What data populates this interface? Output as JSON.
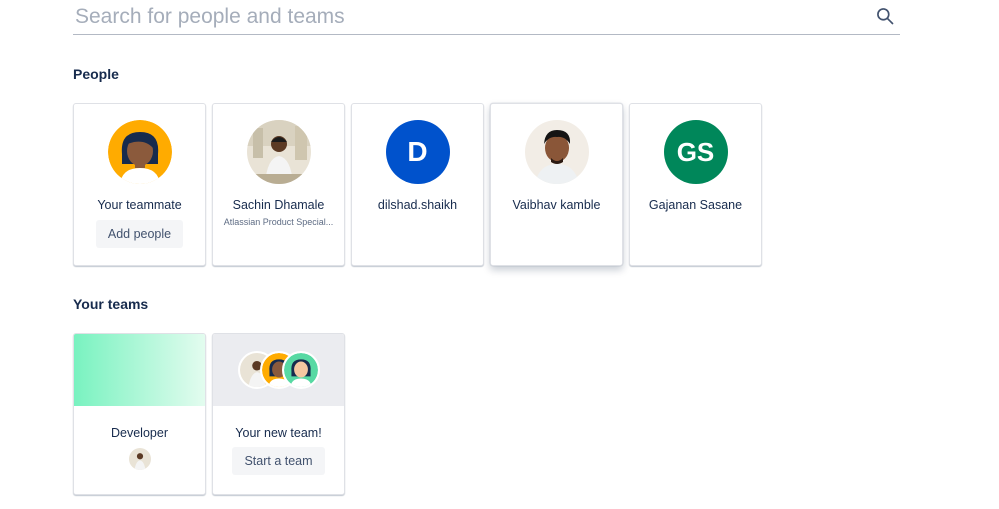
{
  "search": {
    "placeholder": "Search for people and teams",
    "value": ""
  },
  "people_section": {
    "title": "People",
    "cards": [
      {
        "name": "Your teammate",
        "subtitle": "",
        "button": "Add people",
        "avatar": "teammate-illustration"
      },
      {
        "name": "Sachin Dhamale",
        "subtitle": "Atlassian Product Special...",
        "avatar": "photo"
      },
      {
        "name": "dilshad.shaikh",
        "subtitle": "",
        "initials": "D",
        "color": "#0052cc"
      },
      {
        "name": "Vaibhav kamble",
        "subtitle": "",
        "avatar": "photo"
      },
      {
        "name": "Gajanan Sasane",
        "subtitle": "",
        "initials": "GS",
        "color": "#00875a"
      }
    ]
  },
  "teams_section": {
    "title": "Your teams",
    "cards": [
      {
        "name": "Developer",
        "banner_colors": [
          "#79f2c0",
          "#e3fcef"
        ]
      },
      {
        "name": "Your new team!",
        "button": "Start a team"
      }
    ]
  },
  "colors": {
    "accent_blue": "#0052cc",
    "accent_green": "#00875a",
    "teammate_yellow": "#ffab00"
  }
}
